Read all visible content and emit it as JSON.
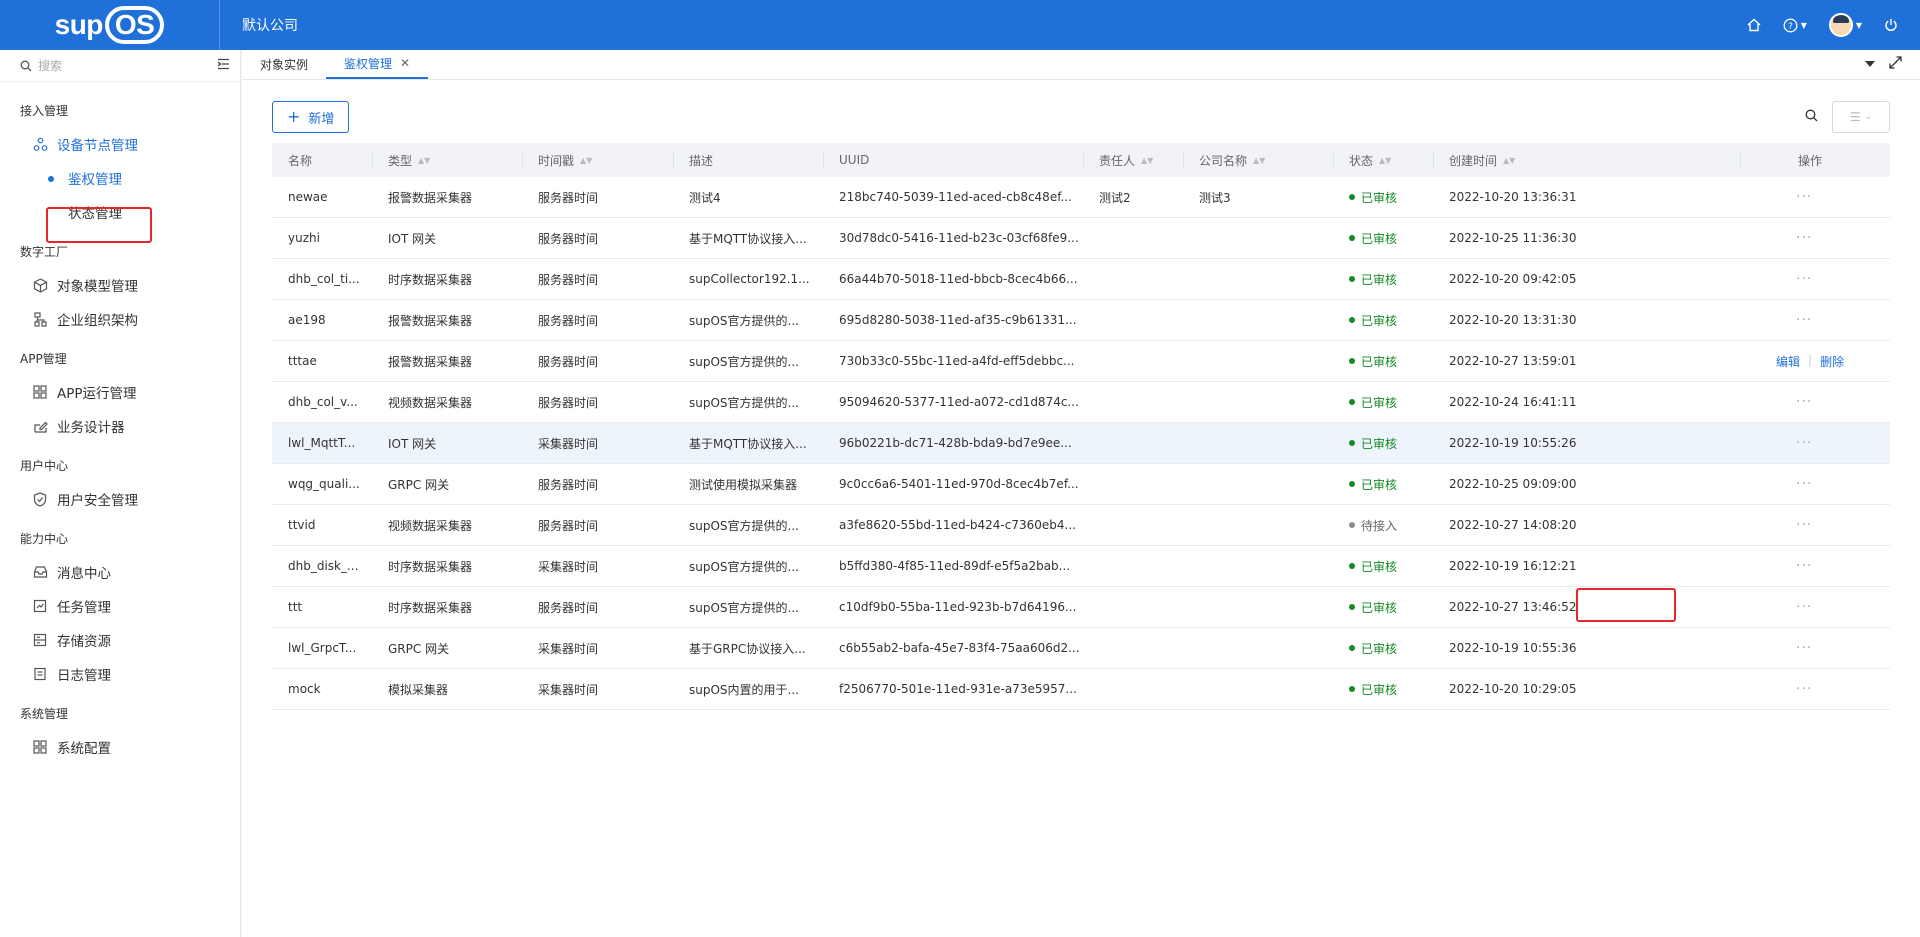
{
  "header": {
    "logo_text_a": "sup",
    "logo_text_b": "OS",
    "company": "默认公司",
    "icons": [
      "home-icon",
      "help-icon",
      "avatar",
      "power-icon"
    ]
  },
  "sidebar": {
    "search_placeholder": "搜索",
    "groups": [
      {
        "title": "接入管理",
        "items": [
          {
            "label": "设备节点管理",
            "icon": "nodes-icon"
          },
          {
            "label": "鉴权管理",
            "sub": true
          },
          {
            "label": "状态管理",
            "sub": true
          }
        ]
      },
      {
        "title": "数字工厂",
        "items": [
          {
            "label": "对象模型管理",
            "icon": "cube-icon"
          },
          {
            "label": "企业组织架构",
            "icon": "org-icon"
          }
        ]
      },
      {
        "title": "APP管理",
        "items": [
          {
            "label": "APP运行管理",
            "icon": "grid-icon"
          },
          {
            "label": "业务设计器",
            "icon": "design-icon"
          }
        ]
      },
      {
        "title": "用户中心",
        "items": [
          {
            "label": "用户安全管理",
            "icon": "shield-icon"
          }
        ]
      },
      {
        "title": "能力中心",
        "items": [
          {
            "label": "消息中心",
            "icon": "inbox-icon"
          },
          {
            "label": "任务管理",
            "icon": "task-icon"
          },
          {
            "label": "存储资源",
            "icon": "storage-icon"
          },
          {
            "label": "日志管理",
            "icon": "log-icon"
          }
        ]
      },
      {
        "title": "系统管理",
        "items": [
          {
            "label": "系统配置",
            "icon": "grid-icon"
          }
        ]
      }
    ]
  },
  "tabs": [
    {
      "label": "对象实例"
    },
    {
      "label": "鉴权管理",
      "active": true
    }
  ],
  "toolbar": {
    "add_label": "新增"
  },
  "table": {
    "columns": [
      "名称",
      "类型",
      "时间戳",
      "描述",
      "UUID",
      "责任人",
      "公司名称",
      "状态",
      "创建时间",
      "操作"
    ],
    "rows": [
      {
        "name": "newae",
        "type": "报警数据采集器",
        "ts": "服务器时间",
        "desc": "测试4",
        "uuid": "218bc740-5039-11ed-aced-cb8c48ef...",
        "owner": "测试2",
        "company": "测试3",
        "status": "已审核",
        "created": "2022-10-20 13:36:31"
      },
      {
        "name": "yuzhi",
        "type": "IOT 网关",
        "ts": "服务器时间",
        "desc": "基于MQTT协议接入...",
        "uuid": "30d78dc0-5416-11ed-b23c-03cf68fe9...",
        "owner": "",
        "company": "",
        "status": "已审核",
        "created": "2022-10-25 11:36:30"
      },
      {
        "name": "dhb_col_ti...",
        "type": "时序数据采集器",
        "ts": "服务器时间",
        "desc": "supCollector192.1...",
        "uuid": "66a44b70-5018-11ed-bbcb-8cec4b66...",
        "owner": "",
        "company": "",
        "status": "已审核",
        "created": "2022-10-20 09:42:05"
      },
      {
        "name": "ae198",
        "type": "报警数据采集器",
        "ts": "服务器时间",
        "desc": "supOS官方提供的...",
        "uuid": "695d8280-5038-11ed-af35-c9b61331...",
        "owner": "",
        "company": "",
        "status": "已审核",
        "created": "2022-10-20 13:31:30"
      },
      {
        "name": "tttae",
        "type": "报警数据采集器",
        "ts": "服务器时间",
        "desc": "supOS官方提供的...",
        "uuid": "730b33c0-55bc-11ed-a4fd-eff5debbc...",
        "owner": "",
        "company": "",
        "status": "已审核",
        "created": "2022-10-27 13:59:01",
        "links": [
          "编辑",
          "删除"
        ]
      },
      {
        "name": "dhb_col_v...",
        "type": "视频数据采集器",
        "ts": "服务器时间",
        "desc": "supOS官方提供的...",
        "uuid": "95094620-5377-11ed-a072-cd1d874c...",
        "owner": "",
        "company": "",
        "status": "已审核",
        "created": "2022-10-24 16:41:11"
      },
      {
        "name": "lwl_MqttT...",
        "type": "IOT 网关",
        "ts": "采集器时间",
        "desc": "基于MQTT协议接入...",
        "uuid": "96b0221b-dc71-428b-bda9-bd7e9ee...",
        "owner": "",
        "company": "",
        "status": "已审核",
        "created": "2022-10-19 10:55:26",
        "hover": true
      },
      {
        "name": "wqg_quali...",
        "type": "GRPC 网关",
        "ts": "服务器时间",
        "desc": "测试使用模拟采集器",
        "uuid": "9c0cc6a6-5401-11ed-970d-8cec4b7ef...",
        "owner": "",
        "company": "",
        "status": "已审核",
        "created": "2022-10-25 09:09:00"
      },
      {
        "name": "ttvid",
        "type": "视频数据采集器",
        "ts": "服务器时间",
        "desc": "supOS官方提供的...",
        "uuid": "a3fe8620-55bd-11ed-b424-c7360eb4...",
        "owner": "",
        "company": "",
        "status": "待接入",
        "pending": true,
        "created": "2022-10-27 14:08:20"
      },
      {
        "name": "dhb_disk_...",
        "type": "时序数据采集器",
        "ts": "采集器时间",
        "desc": "supOS官方提供的...",
        "uuid": "b5ffd380-4f85-11ed-89df-e5f5a2bab...",
        "owner": "",
        "company": "",
        "status": "已审核",
        "created": "2022-10-19 16:12:21"
      },
      {
        "name": "ttt",
        "type": "时序数据采集器",
        "ts": "服务器时间",
        "desc": "supOS官方提供的...",
        "uuid": "c10df9b0-55ba-11ed-923b-b7d64196...",
        "owner": "",
        "company": "",
        "status": "已审核",
        "created": "2022-10-27 13:46:52"
      },
      {
        "name": "lwl_GrpcT...",
        "type": "GRPC 网关",
        "ts": "采集器时间",
        "desc": "基于GRPC协议接入...",
        "uuid": "c6b55ab2-bafa-45e7-83f4-75aa606d2...",
        "owner": "",
        "company": "",
        "status": "已审核",
        "created": "2022-10-19 10:55:36"
      },
      {
        "name": "mock",
        "type": "模拟采集器",
        "ts": "采集器时间",
        "desc": "supOS内置的用于...",
        "uuid": "f2506770-501e-11ed-931e-a73e5957...",
        "owner": "",
        "company": "",
        "status": "已审核",
        "created": "2022-10-20 10:29:05"
      }
    ]
  },
  "colors": {
    "brand": "#1f70d8",
    "approved": "#148a25",
    "pending": "#8c8c8c",
    "highlight": "#e5262a"
  }
}
